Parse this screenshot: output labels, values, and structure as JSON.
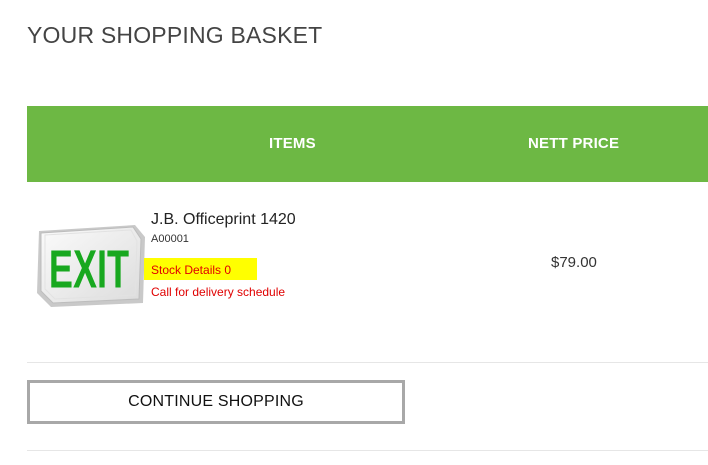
{
  "page": {
    "title": "YOUR SHOPPING BASKET"
  },
  "colors": {
    "header_green": "#6db844",
    "stock_highlight": "#ffff00",
    "alert_red": "#e00000"
  },
  "table": {
    "headers": {
      "items": "ITEMS",
      "price": "NETT PRICE"
    },
    "rows": [
      {
        "image": "exit-sign-image",
        "image_text": "EXIT",
        "name": "J.B. Officeprint 1420",
        "sku": "A00001",
        "stock": "Stock Details 0",
        "delivery_note": "Call for delivery schedule",
        "price": "$79.00"
      }
    ]
  },
  "actions": {
    "continue_label": "CONTINUE SHOPPING"
  }
}
